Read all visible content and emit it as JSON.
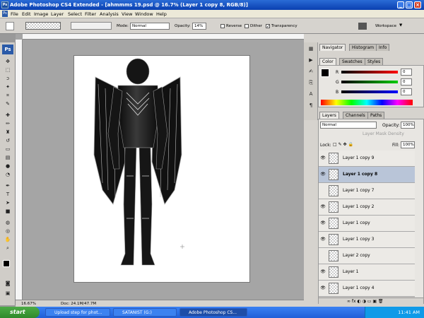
{
  "window": {
    "title": "Adobe Photoshop CS4 Extended - [ahmmms 19.psd @ 16.7% (Layer 1 copy 8, RGB/8)]",
    "app_badge": "Ps"
  },
  "menu": [
    "File",
    "Edit",
    "Image",
    "Layer",
    "Select",
    "Filter",
    "Analysis",
    "View",
    "Window",
    "Help"
  ],
  "options": {
    "mode_label": "Mode:",
    "mode_value": "Normal",
    "opacity_label": "Opacity:",
    "opacity_value": "14%",
    "reverse_label": "Reverse",
    "dither_label": "Dither",
    "transparency_label": "Transparency",
    "workspace_label": "Workspace"
  },
  "status": {
    "zoom": "16.67%",
    "doc": "Doc: 24.1M/47.7M"
  },
  "navigator_panel": {
    "tabs": [
      "Navigator",
      "Histogram",
      "Info"
    ]
  },
  "color_panel": {
    "tabs": [
      "Color",
      "Swatches",
      "Styles"
    ],
    "channels": [
      {
        "label": "R",
        "value": "0",
        "color": "#d00000"
      },
      {
        "label": "G",
        "value": "0",
        "color": "#00a000"
      },
      {
        "label": "B",
        "value": "0",
        "color": "#0000d0"
      }
    ]
  },
  "layers_panel": {
    "tabs": [
      "Layers",
      "Channels",
      "Paths"
    ],
    "blend_mode": "Normal",
    "opacity_label": "Opacity:",
    "opacity_value": "100%",
    "layer_mask_density": "Layer Mask Density",
    "lock_label": "Lock:",
    "fill_label": "Fill:",
    "fill_value": "100%",
    "layers": [
      {
        "name": "Layer 1 copy 9",
        "visible": true,
        "selected": false
      },
      {
        "name": "Layer 1 copy 8",
        "visible": true,
        "selected": true
      },
      {
        "name": "Layer 1 copy 7",
        "visible": false,
        "selected": false
      },
      {
        "name": "Layer 1 copy 2",
        "visible": true,
        "selected": false
      },
      {
        "name": "Layer 1 copy",
        "visible": true,
        "selected": false
      },
      {
        "name": "Layer 1 copy 3",
        "visible": true,
        "selected": false
      },
      {
        "name": "Layer 2 copy",
        "visible": false,
        "selected": false
      },
      {
        "name": "Layer 1",
        "visible": true,
        "selected": false
      },
      {
        "name": "Layer 1 copy 4",
        "visible": true,
        "selected": false
      }
    ]
  },
  "taskbar": {
    "start": "start",
    "items": [
      {
        "label": "Upload step for phot...",
        "active": false
      },
      {
        "label": "SATANIST (G:)",
        "active": false
      },
      {
        "label": "Adobe Photoshop CS...",
        "active": true
      }
    ],
    "clock": "11:41 AM"
  }
}
